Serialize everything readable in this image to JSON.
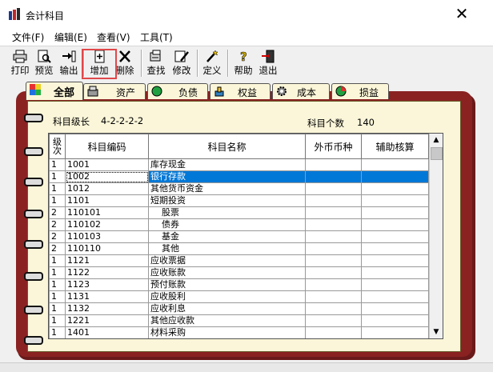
{
  "window": {
    "title": "会计科目",
    "close_glyph": "✕"
  },
  "menu": [
    "文件(F)",
    "编辑(E)",
    "查看(V)",
    "工具(T)"
  ],
  "toolbar": {
    "print": "打印",
    "preview": "预览",
    "export": "输出",
    "add": "增加",
    "delete": "删除",
    "find": "查找",
    "modify": "修改",
    "define": "定义",
    "help": "帮助",
    "exit": "退出"
  },
  "tabs": [
    "全部",
    "资产",
    "负债",
    "权益",
    "成本",
    "损益"
  ],
  "info": {
    "level_label": "科目级长",
    "level_value": "4-2-2-2-2",
    "count_label": "科目个数",
    "count_value": "140"
  },
  "table": {
    "headers": [
      "级次",
      "科目编码",
      "科目名称",
      "外币币种",
      "辅助核算"
    ],
    "rows": [
      {
        "level": "1",
        "code": "1001",
        "name": "库存现金",
        "currency": "",
        "aux": ""
      },
      {
        "level": "1",
        "code": "1002",
        "name": "银行存款",
        "currency": "",
        "aux": ""
      },
      {
        "level": "1",
        "code": "1012",
        "name": "其他货币资金",
        "currency": "",
        "aux": ""
      },
      {
        "level": "1",
        "code": "1101",
        "name": "短期投资",
        "currency": "",
        "aux": ""
      },
      {
        "level": "2",
        "code": "110101",
        "name": "股票",
        "currency": "",
        "aux": ""
      },
      {
        "level": "2",
        "code": "110102",
        "name": "债券",
        "currency": "",
        "aux": ""
      },
      {
        "level": "2",
        "code": "110103",
        "name": "基金",
        "currency": "",
        "aux": ""
      },
      {
        "level": "2",
        "code": "110110",
        "name": "其他",
        "currency": "",
        "aux": ""
      },
      {
        "level": "1",
        "code": "1121",
        "name": "应收票据",
        "currency": "",
        "aux": ""
      },
      {
        "level": "1",
        "code": "1122",
        "name": "应收账款",
        "currency": "",
        "aux": ""
      },
      {
        "level": "1",
        "code": "1123",
        "name": "预付账款",
        "currency": "",
        "aux": ""
      },
      {
        "level": "1",
        "code": "1131",
        "name": "应收股利",
        "currency": "",
        "aux": ""
      },
      {
        "level": "1",
        "code": "1132",
        "name": "应收利息",
        "currency": "",
        "aux": ""
      },
      {
        "level": "1",
        "code": "1221",
        "name": "其他应收款",
        "currency": "",
        "aux": ""
      },
      {
        "level": "1",
        "code": "1401",
        "name": "材料采购",
        "currency": "",
        "aux": ""
      }
    ],
    "selected_row": 1
  },
  "colors": {
    "selection": "#0078d7",
    "book_cover": "#8a2222",
    "page": "#fbf6d9",
    "highlight_box": "#e0484a"
  },
  "icons": [
    "app-book-icon",
    "printer-icon",
    "preview-icon",
    "export-icon",
    "add-doc-icon",
    "delete-x-icon",
    "find-icon",
    "modify-icon",
    "wand-icon",
    "help-icon",
    "exit-door-icon",
    "scroll-up-icon",
    "scroll-down-icon"
  ]
}
